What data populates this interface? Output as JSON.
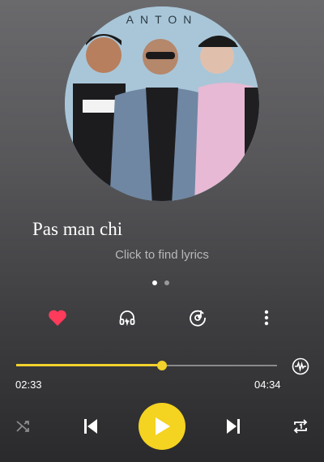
{
  "album_art": {
    "text": "ANTON"
  },
  "track": {
    "title": "Pas man chi"
  },
  "lyrics": {
    "label": "Click to find lyrics"
  },
  "pager": {
    "pages": 2,
    "active": 0
  },
  "actions": {
    "favorite_icon": "heart-icon",
    "headphones_icon": "headphones-icon",
    "equalizer_icon": "equalizer-disc-icon",
    "more_icon": "more-vertical-icon"
  },
  "progress": {
    "elapsed": "02:33",
    "total": "04:34",
    "fraction": 0.56,
    "fill_color": "#f2d22b"
  },
  "controls": {
    "shuffle_icon": "shuffle-icon",
    "previous_icon": "skip-previous-icon",
    "play_icon": "play-icon",
    "next_icon": "skip-next-icon",
    "repeat_icon": "repeat-one-icon",
    "play_color": "#f4d321"
  },
  "colors": {
    "accent": "#f2d22b",
    "heart": "#ff3b5c"
  }
}
